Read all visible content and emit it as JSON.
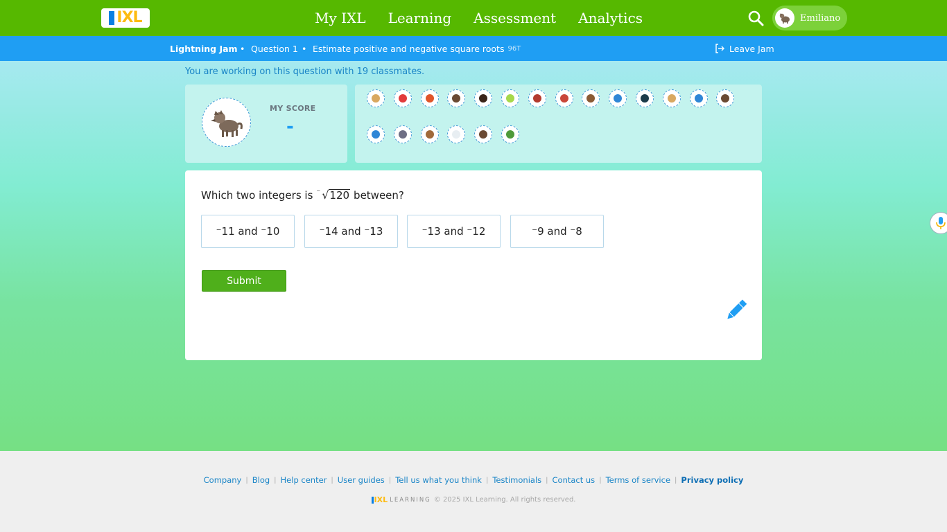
{
  "nav": {
    "logo_text": "IXL",
    "links": [
      "My IXL",
      "Learning",
      "Assessment",
      "Analytics"
    ],
    "user_name": "Emiliano"
  },
  "jam": {
    "title": "Lightning Jam",
    "question": "Question 1",
    "skill": "Estimate positive and negative square roots",
    "skill_code": "96T",
    "leave": "Leave Jam"
  },
  "classmates_text": "You are working on this question with 19 classmates.",
  "score": {
    "label": "MY SCORE",
    "value": "-"
  },
  "classmate_icons": [
    "camel-icon",
    "strawberry-icon",
    "parrot-icon",
    "bear-icon",
    "fire-icon",
    "lime-icon",
    "soldier-icon",
    "nutcracker-icon",
    "beaver-icon",
    "butterfly-icon",
    "orca-icon",
    "camel-icon",
    "butterfly-icon",
    "bear-icon",
    "butterfly-icon",
    "raccoon-icon",
    "monkey-icon",
    "cloud-icon",
    "bear-icon",
    "signpost-icon"
  ],
  "question": {
    "prefix": "Which two integers is",
    "neg": "⁻",
    "radicand": "120",
    "suffix": "between?",
    "choices": [
      "⁻11 and ⁻10",
      "⁻14 and ⁻13",
      "⁻13 and ⁻12",
      "⁻9 and ⁻8"
    ],
    "submit": "Submit"
  },
  "footer": {
    "links": [
      "Company",
      "Blog",
      "Help center",
      "User guides",
      "Tell us what you think",
      "Testimonials",
      "Contact us",
      "Terms of service",
      "Privacy policy"
    ],
    "logo_word": "LEARNING",
    "copyright": "© 2025 IXL Learning. All rights reserved."
  },
  "colors": {
    "nav_green": "#56b800",
    "jam_blue": "#1f9ef3",
    "submit_green": "#4faf1b",
    "accent_blue": "#1a85c7"
  }
}
